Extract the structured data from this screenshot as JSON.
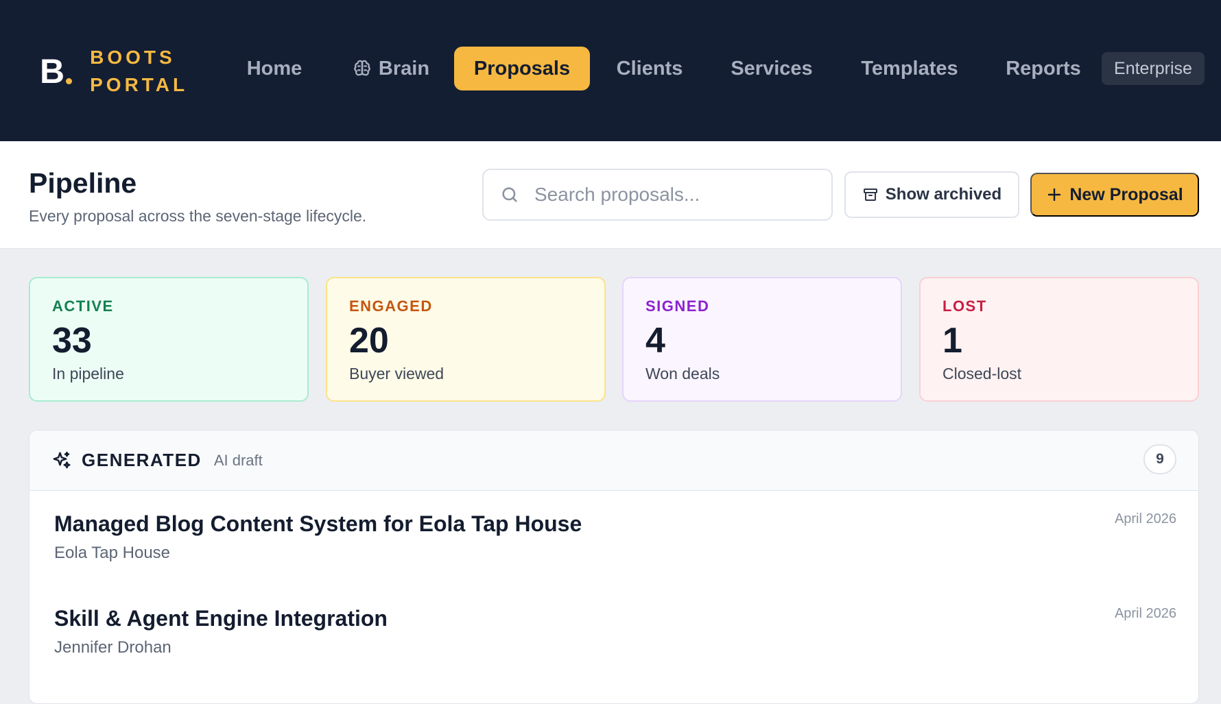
{
  "brand": {
    "mark": "B",
    "line1": "BOOTS",
    "line2": "PORTAL",
    "accent": "#f5b942"
  },
  "nav": {
    "items": [
      {
        "label": "Home"
      },
      {
        "label": "Brain",
        "icon": "brain-icon"
      },
      {
        "label": "Proposals",
        "active": true
      },
      {
        "label": "Clients"
      },
      {
        "label": "Services"
      },
      {
        "label": "Templates"
      },
      {
        "label": "Reports"
      }
    ],
    "plan_badge": "Enterprise"
  },
  "header": {
    "title": "Pipeline",
    "subtitle": "Every proposal across the seven-stage lifecycle.",
    "search_placeholder": "Search proposals...",
    "show_archived_label": "Show archived",
    "new_proposal_label": "New Proposal"
  },
  "stats": [
    {
      "label": "ACTIVE",
      "value": "33",
      "desc": "In pipeline",
      "color": "#13804f"
    },
    {
      "label": "ENGAGED",
      "value": "20",
      "desc": "Buyer viewed",
      "color": "#c4560f"
    },
    {
      "label": "SIGNED",
      "value": "4",
      "desc": "Won deals",
      "color": "#8b22cf"
    },
    {
      "label": "LOST",
      "value": "1",
      "desc": "Closed-lost",
      "color": "#c81e44"
    }
  ],
  "group": {
    "name": "GENERATED",
    "subtitle": "AI draft",
    "count": "9",
    "icon": "sparkles-icon",
    "rows": [
      {
        "title": "Managed Blog Content System for Eola Tap House",
        "client": "Eola Tap House",
        "date": "April 2026"
      },
      {
        "title": "Skill & Agent Engine Integration",
        "client": "Jennifer Drohan",
        "date": "April 2026"
      }
    ]
  }
}
